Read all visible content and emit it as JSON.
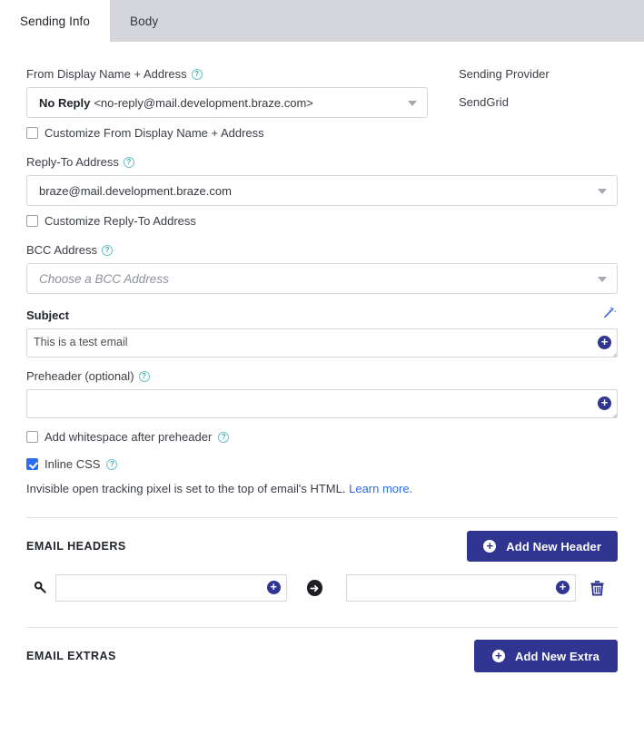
{
  "tabs": [
    {
      "label": "Sending Info",
      "active": true
    },
    {
      "label": "Body",
      "active": false
    }
  ],
  "form": {
    "from": {
      "label": "From Display Name + Address",
      "help": "?",
      "display_name": "No Reply",
      "address": "<no-reply@mail.development.braze.com>",
      "customize_label": "Customize From Display Name + Address",
      "customize_checked": false
    },
    "sending_provider": {
      "label": "Sending Provider",
      "value": "SendGrid"
    },
    "reply_to": {
      "label": "Reply-To Address",
      "help": "?",
      "value": "braze@mail.development.braze.com",
      "customize_label": "Customize Reply-To Address",
      "customize_checked": false
    },
    "bcc": {
      "label": "BCC Address",
      "help": "?",
      "placeholder": "Choose a BCC Address"
    },
    "subject": {
      "label": "Subject",
      "value": "This is a test email",
      "wand_icon": "magic-wand-icon",
      "plus_icon": "+"
    },
    "preheader": {
      "label": "Preheader (optional)",
      "help": "?",
      "value": "",
      "plus_icon": "+"
    },
    "whitespace": {
      "label": "Add whitespace after preheader",
      "help": "?",
      "checked": false
    },
    "inline_css": {
      "label": "Inline CSS",
      "help": "?",
      "checked": true
    },
    "tracking_note": {
      "text": "Invisible open tracking pixel is set to the top of email's HTML.",
      "link": "Learn more."
    }
  },
  "email_headers": {
    "title": "EMAIL HEADERS",
    "add_button": "Add New Header",
    "add_icon": "+",
    "rows": [
      {
        "key_icon": "key-icon",
        "key_value": "",
        "key_plus": "+",
        "arrow_icon": "→",
        "value_value": "",
        "value_plus": "+",
        "delete_icon": "trash-icon"
      }
    ]
  },
  "email_extras": {
    "title": "EMAIL EXTRAS",
    "add_button": "Add New Extra",
    "add_icon": "+"
  },
  "colors": {
    "primary": "#2f3590",
    "link": "#2c6ef2",
    "checkbox_checked": "#2c6ef2",
    "help_icon": "#3fa9b2",
    "tabbar_bg": "#d4d6db"
  }
}
